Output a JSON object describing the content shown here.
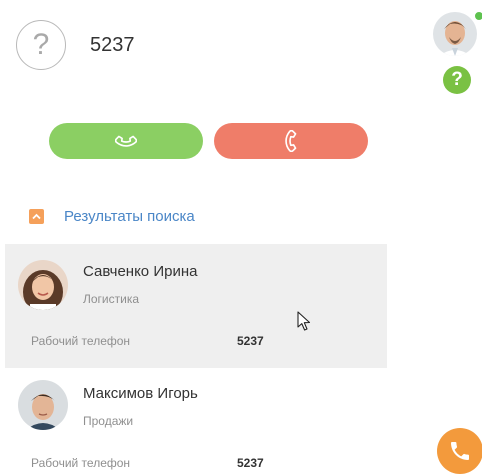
{
  "call": {
    "number": "5237",
    "caller_avatar_icon": "question-mark-icon",
    "answer_icon": "phone-icon",
    "hangup_icon": "phone-hangup-icon"
  },
  "search": {
    "title": "Результаты поиска",
    "toggle_icon": "chevron-up-icon"
  },
  "contacts": [
    {
      "name": "Савченко Ирина",
      "department": "Логистика",
      "phone_label": "Рабочий телефон",
      "phone_value": "5237"
    },
    {
      "name": "Максимов Игорь",
      "department": "Продажи",
      "phone_label": "Рабочий телефон",
      "phone_value": "5237"
    }
  ],
  "sidebar": {
    "help_label": "?",
    "status": "online",
    "phone_icon": "phone-icon"
  },
  "colors": {
    "answer": "#8bcf63",
    "hangup": "#ef7d69",
    "accent": "#4a86c7",
    "toggle": "#f5a05a",
    "help": "#7ac143",
    "fab": "#f39a3c",
    "status": "#5ec24f"
  }
}
